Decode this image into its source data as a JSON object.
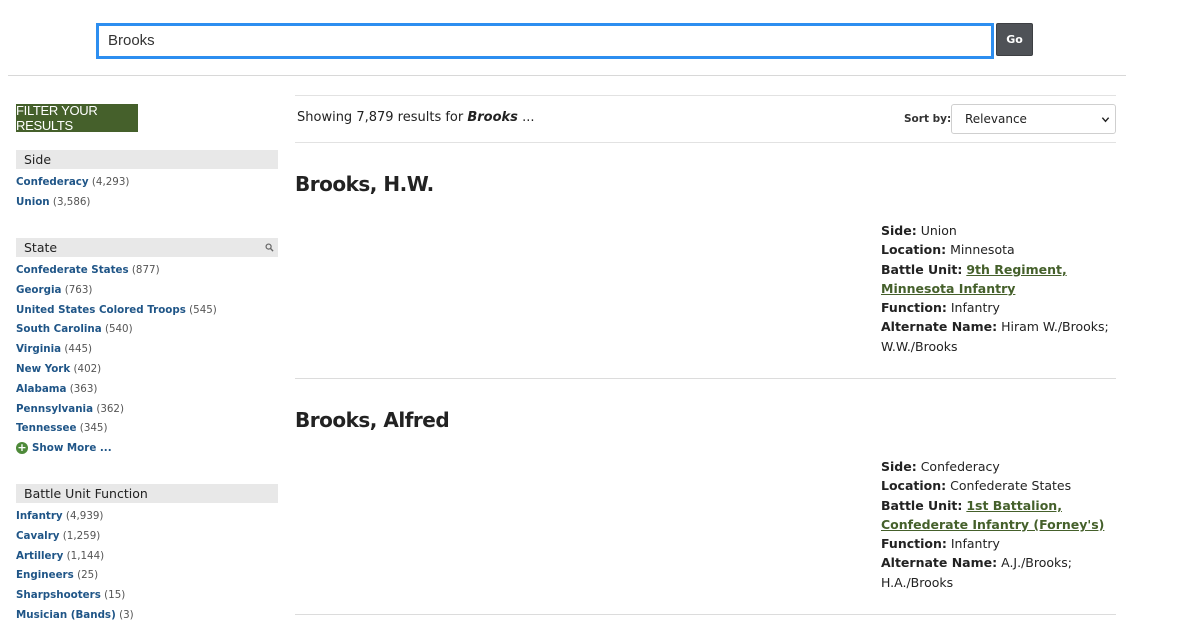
{
  "search": {
    "value": "Brooks",
    "button_label": "Go"
  },
  "sidebar": {
    "filter_header": "Filter your results",
    "show_more_label": "Show More ...",
    "facets": [
      {
        "title": "Side",
        "items": [
          {
            "label": "Confederacy",
            "count": "(4,293)"
          },
          {
            "label": "Union",
            "count": "(3,586)"
          }
        ]
      },
      {
        "title": "State",
        "items": [
          {
            "label": "Confederate States",
            "count": "(877)"
          },
          {
            "label": "Georgia",
            "count": "(763)"
          },
          {
            "label": "United States Colored Troops",
            "count": "(545)"
          },
          {
            "label": "South Carolina",
            "count": "(540)"
          },
          {
            "label": "Virginia",
            "count": "(445)"
          },
          {
            "label": "New York",
            "count": "(402)"
          },
          {
            "label": "Alabama",
            "count": "(363)"
          },
          {
            "label": "Pennsylvania",
            "count": "(362)"
          },
          {
            "label": "Tennessee",
            "count": "(345)"
          }
        ]
      },
      {
        "title": "Battle Unit Function",
        "items": [
          {
            "label": "Infantry",
            "count": "(4,939)"
          },
          {
            "label": "Cavalry",
            "count": "(1,259)"
          },
          {
            "label": "Artillery",
            "count": "(1,144)"
          },
          {
            "label": "Engineers",
            "count": "(25)"
          },
          {
            "label": "Sharpshooters",
            "count": "(15)"
          },
          {
            "label": "Musician (Bands)",
            "count": "(3)"
          }
        ]
      }
    ]
  },
  "results": {
    "summary_prefix": "Showing 7,879 results for ",
    "summary_term": "Brooks",
    "summary_suffix": " ...",
    "sort_label": "Sort by:",
    "sort_value": "Relevance",
    "labels": {
      "side": "Side:",
      "location": "Location:",
      "battle_unit": "Battle Unit:",
      "function": "Function:",
      "alternate_name": "Alternate Name:"
    },
    "items": [
      {
        "name": "Brooks, H.W.",
        "side": "Union",
        "location": "Minnesota",
        "battle_unit": "9th Regiment, Minnesota Infantry",
        "function": "Infantry",
        "alternate_name": "Hiram W./Brooks; W.W./Brooks"
      },
      {
        "name": "Brooks, Alfred",
        "side": "Confederacy",
        "location": "Confederate States",
        "battle_unit": "1st Battalion, Confederate Infantry (Forney's)",
        "function": "Infantry",
        "alternate_name": "A.J./Brooks; H.A./Brooks"
      }
    ]
  },
  "colors": {
    "accent_green": "#45602b",
    "link_blue": "#1f5587",
    "focus_blue": "#2d8ef0",
    "go_button": "#4f5257"
  }
}
